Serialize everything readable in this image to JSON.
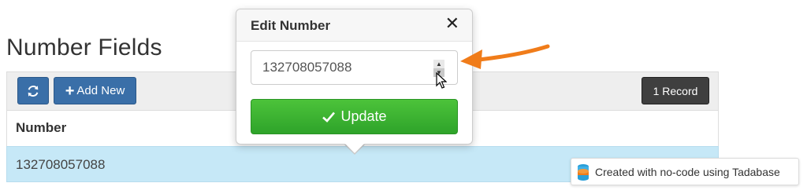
{
  "page": {
    "title": "Number Fields"
  },
  "toolbar": {
    "refresh_icon": "refresh-icon",
    "add_label": "Add New",
    "add_icon": "plus-icon",
    "records_label": "1 Record"
  },
  "table": {
    "columns": [
      "Number"
    ],
    "rows": [
      [
        "132708057088"
      ]
    ]
  },
  "popover": {
    "title": "Edit Number",
    "close_glyph": "✕",
    "input_value": "132708057088",
    "update_label": "Update",
    "update_icon": "check-icon"
  },
  "badge": {
    "text": "Created with no-code using Tadabase",
    "icon": "database-icon"
  },
  "colors": {
    "primary": "#3a6fa8",
    "dark": "#3f3f3f",
    "success": "#3bb333",
    "row_highlight": "#c6e8f7",
    "annotation": "#f07c1a"
  }
}
